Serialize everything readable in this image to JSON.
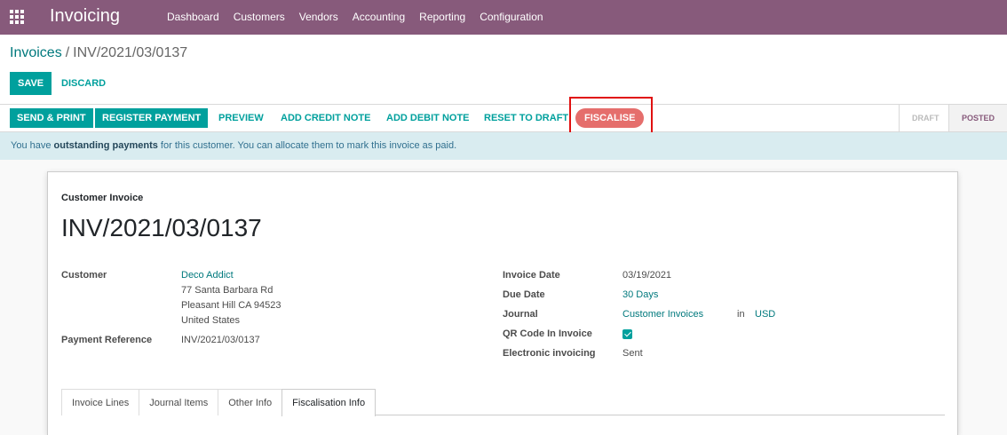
{
  "app": {
    "title": "Invoicing"
  },
  "menu": [
    "Dashboard",
    "Customers",
    "Vendors",
    "Accounting",
    "Reporting",
    "Configuration"
  ],
  "breadcrumb": {
    "parent": "Invoices",
    "separator": "/",
    "current": "INV/2021/03/0137"
  },
  "actions": {
    "save": "SAVE",
    "discard": "DISCARD"
  },
  "statusbar": {
    "buttons": {
      "send_print": "SEND & PRINT",
      "register_payment": "REGISTER PAYMENT",
      "preview": "PREVIEW",
      "add_credit_note": "ADD CREDIT NOTE",
      "add_debit_note": "ADD DEBIT NOTE",
      "reset_to_draft": "RESET TO DRAFT",
      "fiscalise": "FISCALISE"
    },
    "stages": {
      "draft": "DRAFT",
      "posted": "POSTED"
    }
  },
  "alert": {
    "before": "You have ",
    "bold": "outstanding payments",
    "after": " for this customer. You can allocate them to mark this invoice as paid."
  },
  "invoice": {
    "type": "Customer Invoice",
    "name": "INV/2021/03/0137",
    "customer_label": "Customer",
    "customer_name": "Deco Addict",
    "address_line1": "77 Santa Barbara Rd",
    "address_line2": "Pleasant Hill CA 94523",
    "address_line3": "United States",
    "payment_ref_label": "Payment Reference",
    "payment_ref": "INV/2021/03/0137",
    "invoice_date_label": "Invoice Date",
    "invoice_date": "03/19/2021",
    "due_date_label": "Due Date",
    "due_date": "30 Days",
    "journal_label": "Journal",
    "journal": "Customer Invoices",
    "journal_in": "in",
    "currency": "USD",
    "qr_label": "QR Code In Invoice",
    "einvoicing_label": "Electronic invoicing",
    "einvoicing": "Sent"
  },
  "tabs": [
    "Invoice Lines",
    "Journal Items",
    "Other Info",
    "Fiscalisation Info"
  ],
  "colors": {
    "brand": "#875a7b",
    "primary": "#00a09d",
    "danger": "#e56e6c",
    "highlight": "#e01010"
  }
}
